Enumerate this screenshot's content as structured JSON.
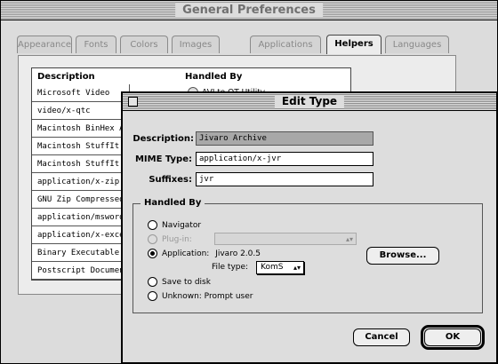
{
  "prefs_window": {
    "title": "General Preferences",
    "tabs": [
      {
        "label": "Appearance",
        "active": false
      },
      {
        "label": "Fonts",
        "active": false
      },
      {
        "label": "Colors",
        "active": false
      },
      {
        "label": "Images",
        "active": false
      },
      {
        "label": "Applications",
        "active": false
      },
      {
        "label": "Helpers",
        "active": true
      },
      {
        "label": "Languages",
        "active": false
      }
    ],
    "list": {
      "col_description": "Description",
      "col_handled_by": "Handled By",
      "rows": [
        "Microsoft Video",
        "video/x-qtc",
        "Macintosh BinHex Ar",
        "Macintosh StuffIt Ar",
        "Macintosh StuffIt Ar",
        "application/x-zip",
        "GNU Zip Compressed",
        "application/msword",
        "application/x-excel",
        "Binary Executable",
        "Postscript Document"
      ],
      "first_row_handler": "AVI to QT Utility"
    }
  },
  "dialog": {
    "title": "Edit Type",
    "description_label": "Description:",
    "description_value": "Jivaro Archive",
    "mime_label": "MIME Type:",
    "mime_value": "application/x-jvr",
    "suffixes_label": "Suffixes:",
    "suffixes_value": "jvr",
    "handled_by": {
      "title": "Handled By",
      "navigator": "Navigator",
      "plugin": "Plug-in:",
      "application": "Application:",
      "application_name": "Jivaro 2.0.5",
      "file_type_label": "File type:",
      "file_type_value": "KomS",
      "save_to_disk": "Save to disk",
      "unknown": "Unknown: Prompt user",
      "selected": "application"
    },
    "browse_button": "Browse...",
    "cancel_button": "Cancel",
    "ok_button": "OK"
  }
}
